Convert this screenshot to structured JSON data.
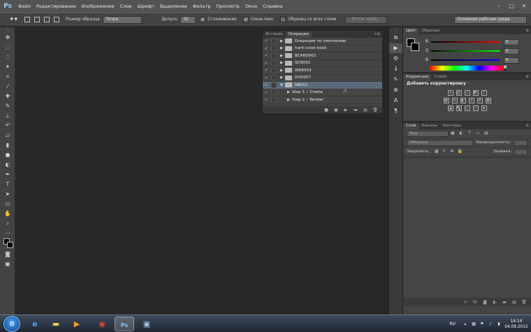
{
  "app": {
    "logo": "Ps",
    "menu": [
      "Файл",
      "Редактирование",
      "Изображение",
      "Слои",
      "Шрифт",
      "Выделение",
      "Фильтр",
      "Просмотр",
      "Окно",
      "Справка"
    ],
    "window_controls": [
      "–",
      "□",
      "✕"
    ]
  },
  "options": {
    "sample_size_label": "Размер образца:",
    "sample_size_value": "Точка",
    "tolerance_label": "Допуск:",
    "tolerance_value": "32",
    "antialias_label": "Сглаживание",
    "antialias_checked": true,
    "contiguous_label": "Смеж.пикс",
    "contiguous_checked": true,
    "sample_all_label": "Образец со всех слоев",
    "sample_all_checked": false,
    "refine_edge_label": "Уточн. край...",
    "workspace": "Основная рабочая среда"
  },
  "actions_panel": {
    "tabs": [
      "История",
      "Операции"
    ],
    "active_tab": "Операции",
    "rows": [
      {
        "label": "Операции по умолчанию",
        "expanded": false,
        "type": "folder"
      },
      {
        "label": "hard cover book",
        "expanded": false,
        "type": "folder"
      },
      {
        "label": "BCARD002",
        "expanded": false,
        "type": "folder"
      },
      {
        "label": "SCN001",
        "expanded": false,
        "type": "folder"
      },
      {
        "label": "WEB003",
        "expanded": false,
        "type": "folder"
      },
      {
        "label": "DVD007",
        "expanded": false,
        "type": "folder"
      },
      {
        "label": "NB001",
        "expanded": true,
        "type": "folder",
        "selected": true
      },
      {
        "label": "Step 1 :: Create",
        "expanded": false,
        "type": "action"
      },
      {
        "label": "Step 2 :: Render",
        "expanded": false,
        "type": "action"
      }
    ]
  },
  "color_panel": {
    "tabs": [
      "Цвет",
      "Образцы"
    ],
    "active_tab": "Цвет",
    "channels": [
      {
        "letter": "R",
        "value": "0",
        "color": "#e03030"
      },
      {
        "letter": "G",
        "value": "0",
        "color": "#30c030"
      },
      {
        "letter": "B",
        "value": "0",
        "color": "#3050e0"
      }
    ]
  },
  "adjustments_panel": {
    "tabs": [
      "Коррекция",
      "Стили"
    ],
    "active_tab": "Коррекция",
    "title": "Добавить корректировку"
  },
  "layers_panel": {
    "tabs": [
      "Слои",
      "Каналы",
      "Контуры"
    ],
    "active_tab": "Слои",
    "filter_kind": "Вид",
    "blend_mode": "Обычные",
    "opacity_label": "Непрозрачность:",
    "lock_label": "Закрепить:",
    "fill_label": "Заливка:"
  },
  "taskbar": {
    "language": "RU",
    "time": "14:14",
    "date": "04.09.2015"
  }
}
